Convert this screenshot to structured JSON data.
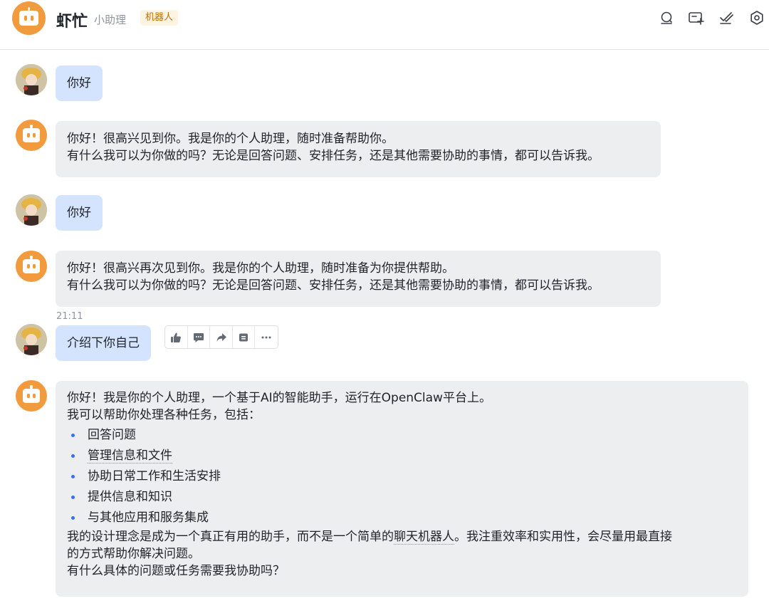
{
  "header": {
    "title": "虾忙",
    "subtitle": "小助理",
    "badge": "机器人",
    "icons": [
      "search-icon",
      "add-screen-icon",
      "check-done-icon",
      "settings-icon"
    ]
  },
  "colors": {
    "bot_avatar": "#f19a3e",
    "user_bubble": "#d5e4fe",
    "bot_bubble": "#eceef0",
    "badge_text": "#c26e00",
    "bullet": "#3370ff"
  },
  "messages": [
    {
      "from": "user",
      "text": "你好"
    },
    {
      "from": "bot",
      "lines": [
        "你好！很高兴见到你。我是你的个人助理，随时准备帮助你。",
        "有什么我可以为你做的吗？无论是回答问题、安排任务，还是其他需要协助的事情，都可以告诉我。"
      ]
    },
    {
      "from": "user",
      "text": "你好"
    },
    {
      "from": "bot",
      "lines": [
        "你好！很高兴再次见到你。我是你的个人助理，随时准备为你提供帮助。",
        "有什么我可以为你做的吗？无论是回答问题、安排任务，还是其他需要协助的事情，都可以告诉我。"
      ]
    },
    {
      "from": "user",
      "time": "21:11",
      "text": "介绍下你自己"
    },
    {
      "from": "bot",
      "intro": "你好！我是你的个人助理，一个基于AI的智能助手，运行在OpenClaw平台上。",
      "lead": "我可以帮助你处理各种任务，包括：",
      "bullets": [
        "回答问题",
        "管理信息和文件",
        "协助日常工作和生活安排",
        "提供信息和知识",
        "与其他应用和服务集成"
      ],
      "design_line1_a": "我的设计理念是成为一个真正有用的助手，而不是一个简单的",
      "design_line1_b": "聊天机器人",
      "design_line1_c": "。我注重效率和实用性，会尽量用最直接",
      "design_line2": "的方式帮助你解决问题。",
      "closing": "有什么具体的问题或任务需要我协助吗？"
    }
  ],
  "message_actions": [
    "thumbs-up-icon",
    "comment-icon",
    "forward-icon",
    "pin-icon",
    "more-icon"
  ]
}
